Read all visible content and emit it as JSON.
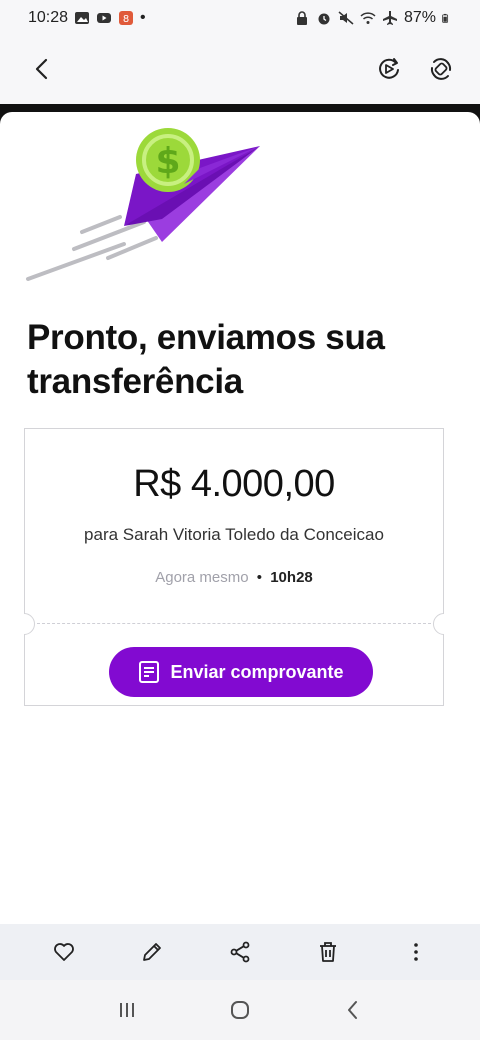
{
  "status_bar": {
    "time": "10:28",
    "dot": "•",
    "battery": "87%"
  },
  "app_bar": {
    "back_icon": "back-arrow-icon",
    "action_icons": [
      "remaster-icon",
      "auto-rotate-icon"
    ]
  },
  "receipt": {
    "headline": "Pronto, enviamos sua transferência",
    "amount": "R$ 4.000,00",
    "recipient": "para Sarah Vitoria Toledo da Conceicao",
    "time_label": "Agora mesmo",
    "bullet": "•",
    "time": "10h28",
    "send_button_label": "Enviar comprovante",
    "accent_color": "#820ad1",
    "coin_color": "#9cd93a"
  },
  "action_bar": {
    "icons": [
      "heart-icon",
      "edit-icon",
      "share-icon",
      "delete-icon",
      "more-icon"
    ]
  },
  "nav_bar": {
    "icons": [
      "recent-apps-icon",
      "home-icon",
      "back-icon"
    ]
  }
}
